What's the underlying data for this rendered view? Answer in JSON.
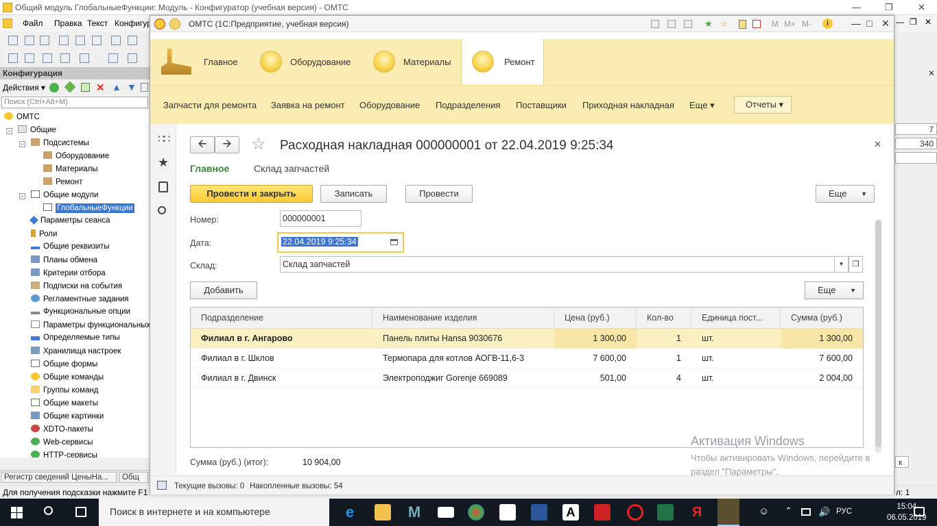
{
  "colors": {
    "accent": "#fbecb1",
    "primary_button": "#f7c934",
    "selection": "#fbf0c2",
    "tree_selection": "#3875d7"
  },
  "config_window": {
    "title": "Общий модуль ГлобальныеФункции: Модуль - Конфигуратор (учебная версия) - ОМТС",
    "menu": [
      "Файл",
      "Правка",
      "Текст",
      "Конфигур"
    ],
    "panel_title": "Конфигурация",
    "actions_label": "Действия",
    "search_placeholder": "Поиск (Ctrl+Alt+M)",
    "tree": {
      "root": "ОМТС",
      "common": "Общие",
      "subsystems": "Подсистемы",
      "sub_items": [
        "Оборудование",
        "Материалы",
        "Ремонт"
      ],
      "common_modules": "Общие модули",
      "selected_module": "ГлобальныеФункции",
      "items": [
        "Параметры сеанса",
        "Роли",
        "Общие реквизиты",
        "Планы обмена",
        "Критерии отбора",
        "Подписки на события",
        "Регламентные задания",
        "Функциональные опции",
        "Параметры функциональных",
        "Определяемые типы",
        "Хранилища настроек",
        "Общие формы",
        "Общие команды",
        "Группы команд",
        "Общие макеты",
        "Общие картинки",
        "XDTO-пакеты",
        "Web-сервисы",
        "HTTP-сервисы"
      ]
    },
    "bottom_tabs": [
      "Регистр сведений ЦеныНа...",
      "Общ"
    ],
    "status": "Для получения подсказки нажмите F1",
    "right_values": [
      "7",
      "340"
    ],
    "right_status": "л: 1",
    "right_button": "к"
  },
  "app_window": {
    "title": "ОМТС  (1С:Предприятие, учебная версия)",
    "toolbar_labels": [
      "M",
      "M+",
      "M-"
    ],
    "sections": [
      {
        "label": "Главное"
      },
      {
        "label": "Оборудование"
      },
      {
        "label": "Материалы"
      },
      {
        "label": "Ремонт",
        "active": true
      }
    ],
    "nav": [
      "Запчасти для ремонта",
      "Заявка на ремонт",
      "Оборудование",
      "Подразделения",
      "Поставщики",
      "Приходная накладная",
      "Еще ▾"
    ],
    "reports": "Отчеты ▾",
    "doc": {
      "title": "Расходная накладная 000000001 от 22.04.2019 9:25:34",
      "tab_main": "Главное",
      "tab_other": "Склад запчастей",
      "btn_post_close": "Провести и закрыть",
      "btn_save": "Записать",
      "btn_post": "Провести",
      "btn_more": "Еще",
      "number_label": "Номер:",
      "number": "000000001",
      "date_label": "Дата:",
      "date": "22.04.2019  9:25:34",
      "warehouse_label": "Склад:",
      "warehouse": "Склад запчастей",
      "btn_add": "Добавить",
      "btn_more2": "Еще",
      "table": {
        "headers": [
          "Подразделение",
          "Наименование изделия",
          "Цена (руб.)",
          "Кол-во",
          "Единица пост...",
          "Сумма (руб.)"
        ],
        "rows": [
          [
            "Филиал в г. Ангарово",
            "Панель плиты Hansa 9030676",
            "1 300,00",
            "1",
            "шт.",
            "1 300,00"
          ],
          [
            "Филиал в г. Шклов",
            "Термопара для котлов АОГВ-11,6-3",
            "7 600,00",
            "1",
            "шт.",
            "7 600,00"
          ],
          [
            "Филиал в г. Двинск",
            "Электроподжиг Gorenje 669089",
            "501,00",
            "4",
            "шт.",
            "2 004,00"
          ]
        ]
      },
      "total_label": "Сумма (руб.) (итог):",
      "total": "10 904,00"
    },
    "status_current": "Текущие вызовы: 0",
    "status_accum": "Накопленные вызовы: 54"
  },
  "activation": {
    "title": "Активация Windows",
    "line1": "Чтобы активировать Windows, перейдите в",
    "line2": "раздел \"Параметры\"."
  },
  "taskbar": {
    "search": "Поиск в интернете и на компьютере",
    "lang": "РУС",
    "time": "15:04",
    "date": "06.05.2019"
  }
}
